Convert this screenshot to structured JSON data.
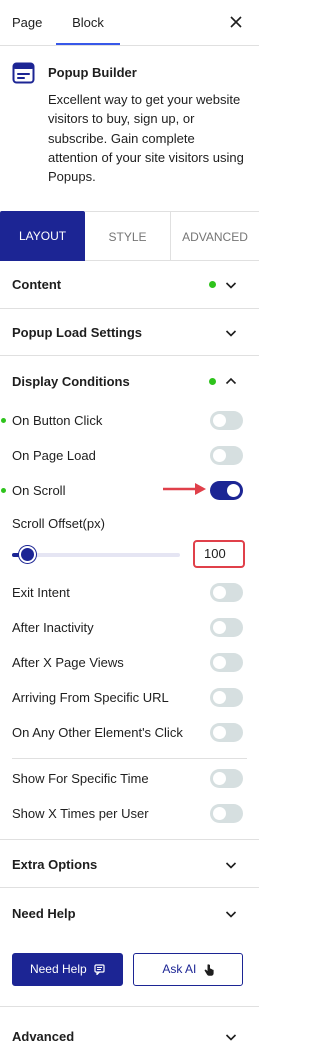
{
  "header": {
    "tabs": [
      {
        "label": "Page",
        "active": false
      },
      {
        "label": "Block",
        "active": true
      }
    ]
  },
  "block": {
    "icon": "popup-window-icon",
    "title": "Popup Builder",
    "description": "Excellent way to get your website visitors to buy, sign up, or subscribe. Gain complete attention of your site visitors using Popups."
  },
  "panel_tabs": [
    {
      "label": "LAYOUT",
      "active": true
    },
    {
      "label": "STYLE",
      "active": false
    },
    {
      "label": "ADVANCED",
      "active": false
    }
  ],
  "sections": {
    "content": {
      "title": "Content",
      "modified": true
    },
    "popup_load": {
      "title": "Popup Load Settings",
      "modified": false
    },
    "display_conditions": {
      "title": "Display Conditions",
      "modified": true,
      "expanded": true
    }
  },
  "conditions": [
    {
      "label": "On Button Click",
      "on": false,
      "modified": true
    },
    {
      "label": "On Page Load",
      "on": false,
      "modified": false
    },
    {
      "label": "On Scroll",
      "on": true,
      "modified": true
    }
  ],
  "scroll_offset": {
    "label": "Scroll Offset(px)",
    "value": "100",
    "slider_fraction": 0.1
  },
  "more_conditions": [
    {
      "label": "Exit Intent",
      "on": false
    },
    {
      "label": "After Inactivity",
      "on": false
    },
    {
      "label": "After X Page Views",
      "on": false
    },
    {
      "label": "Arriving From Specific URL",
      "on": false
    },
    {
      "label": "On Any Other Element's Click",
      "on": false
    }
  ],
  "schedule": [
    {
      "label": "Show For Specific Time",
      "on": false
    },
    {
      "label": "Show X Times per User",
      "on": false
    }
  ],
  "extra_options": {
    "title": "Extra Options"
  },
  "need_help": {
    "title": "Need Help",
    "help_button": "Need Help",
    "ai_button": "Ask AI"
  },
  "advanced": {
    "title": "Advanced"
  },
  "colors": {
    "accent": "#1c2594",
    "modified_dot": "#2ec31c",
    "highlight": "#e0404a"
  }
}
